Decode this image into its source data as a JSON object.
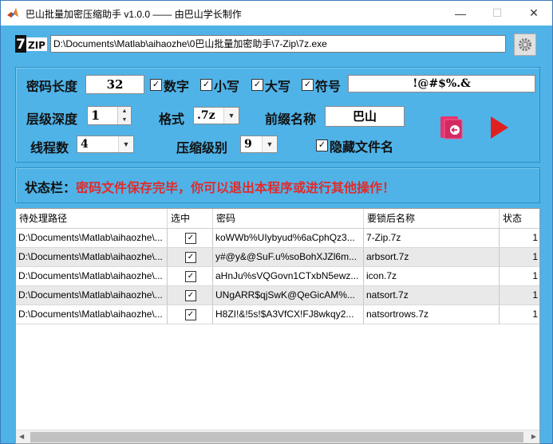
{
  "window": {
    "title": "巴山批量加密压缩助手 v1.0.0 —— 由巴山学长制作",
    "min": "—",
    "max": "☐",
    "close": "✕"
  },
  "toolbar": {
    "logo_big": "7",
    "logo_small": "ZIP",
    "exe_path": "D:\\Documents\\Matlab\\aihaozhe\\0巴山批量加密助手\\7-Zip\\7z.exe",
    "settings_icon": "gear-icon"
  },
  "settings": {
    "pwd_length_label": "密码长度",
    "pwd_length_value": "32",
    "digits_label": "数字",
    "lower_label": "小写",
    "upper_label": "大写",
    "symbol_label": "符号",
    "symbols_value": "!@#$%.&",
    "depth_label": "层级深度",
    "depth_value": "1",
    "format_label": "格式",
    "format_value": ".7z",
    "prefix_label": "前缀名称",
    "prefix_value": "巴山",
    "threads_label": "线程数",
    "threads_value": "4",
    "level_label": "压缩级别",
    "level_value": "9",
    "hide_names_label": "隐藏文件名",
    "digits_checked": true,
    "lower_checked": true,
    "upper_checked": true,
    "symbol_checked": true,
    "hide_checked": true,
    "check_mark": "✓"
  },
  "actions": {
    "export_icon": "export-icon",
    "run_icon": "play-icon",
    "export_color": "#e8336f",
    "run_color": "#e02020"
  },
  "status": {
    "label": "状态栏：",
    "message": "密码文件保存完毕，你可以退出本程序或进行其他操作！"
  },
  "table": {
    "columns": [
      "待处理路径",
      "选中",
      "密码",
      "要锁后名称",
      "状态"
    ],
    "rows": [
      {
        "path": "D:\\Documents\\Matlab\\aihaozhe\\...",
        "selected": true,
        "password": "koWWb%UIybyud%6aCphQz3...",
        "name": "7-Zip.7z",
        "status": "1"
      },
      {
        "path": "D:\\Documents\\Matlab\\aihaozhe\\...",
        "selected": true,
        "password": "y#@y&@SuF.u%soBohXJZl6m...",
        "name": "arbsort.7z",
        "status": "1"
      },
      {
        "path": "D:\\Documents\\Matlab\\aihaozhe\\...",
        "selected": true,
        "password": "aHnJu%sVQGovn1CTxbN5ewz...",
        "name": "icon.7z",
        "status": "1"
      },
      {
        "path": "D:\\Documents\\Matlab\\aihaozhe\\...",
        "selected": true,
        "password": "UNgARR$qjSwK@QeGicAM%...",
        "name": "natsort.7z",
        "status": "1"
      },
      {
        "path": "D:\\Documents\\Matlab\\aihaozhe\\...",
        "selected": true,
        "password": "H8ZI!&!5s!$A3VfCX!FJ8wkqy2...",
        "name": "natsortrows.7z",
        "status": "1"
      }
    ]
  }
}
